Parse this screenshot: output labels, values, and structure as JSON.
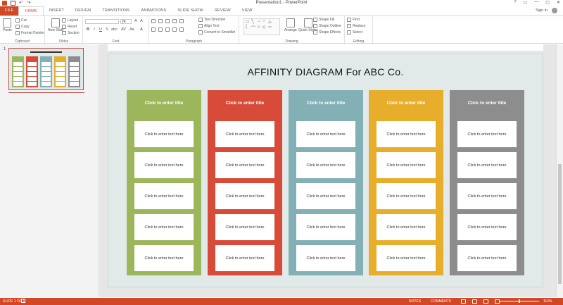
{
  "window": {
    "title": "Presentation1 - PowerPoint",
    "controls": [
      "?",
      "▭",
      "—",
      "▢",
      "✕"
    ]
  },
  "tabs": [
    {
      "label": "FILE"
    },
    {
      "label": "HOME"
    },
    {
      "label": "INSERT"
    },
    {
      "label": "DESIGN"
    },
    {
      "label": "TRANSITIONS"
    },
    {
      "label": "ANIMATIONS"
    },
    {
      "label": "SLIDE SHOW"
    },
    {
      "label": "REVIEW"
    },
    {
      "label": "VIEW"
    }
  ],
  "account": {
    "signin": "Sign in"
  },
  "ribbon": {
    "clipboard": {
      "label": "Clipboard",
      "paste": "Paste",
      "cut": "Cut",
      "copy": "Copy",
      "format_painter": "Format Painter"
    },
    "slides": {
      "label": "Slides",
      "new_slide": "New Slide",
      "layout": "Layout",
      "reset": "Reset",
      "section": "Section"
    },
    "font": {
      "label": "Font",
      "size": "24"
    },
    "paragraph": {
      "label": "Paragraph",
      "text_direction": "Text Direction",
      "align_text": "Align Text",
      "smartart": "Convert to SmartArt"
    },
    "drawing": {
      "label": "Drawing",
      "arrange": "Arrange",
      "quick_styles": "Quick Styles",
      "shape_fill": "Shape Fill",
      "shape_outline": "Shape Outline",
      "shape_effects": "Shape Effects"
    },
    "editing": {
      "label": "Editing",
      "find": "Find",
      "replace": "Replace",
      "select": "Select"
    }
  },
  "thumbnail_pane": {
    "slide_number": "1"
  },
  "slide": {
    "title": "AFFINITY DIAGRAM For ABC Co.",
    "columns": [
      {
        "title": "Click to enter title",
        "color": "#9cb65c",
        "cards": [
          "Click to enter text here",
          "Click to enter text here",
          "Click to enter text here",
          "Click to enter text here",
          "Click to enter text here"
        ]
      },
      {
        "title": "Click to enter title",
        "color": "#d74b38",
        "cards": [
          "Click to enter text here",
          "Click to enter text here",
          "Click to enter text here",
          "Click to enter text here",
          "Click to enter text here"
        ]
      },
      {
        "title": "Click to enter title",
        "color": "#82b0b5",
        "cards": [
          "Click to enter text here",
          "Click to enter text here",
          "Click to enter text here",
          "Click to enter text here",
          "Click to enter text here"
        ]
      },
      {
        "title": "Click to enter title",
        "color": "#e7ae2b",
        "cards": [
          "Click to enter text here",
          "Click to enter text here",
          "Click to enter text here",
          "Click to enter text here",
          "Click to enter text here"
        ]
      },
      {
        "title": "Click to enter title",
        "color": "#8d8d8d",
        "cards": [
          "Click to enter text here",
          "Click to enter text here",
          "Click to enter text here",
          "Click to enter text here",
          "Click to enter text here"
        ]
      }
    ]
  },
  "status": {
    "slide_info": "SLIDE 1 OF 1",
    "notes": "NOTES",
    "comments": "COMMENTS",
    "zoom": "116%"
  },
  "colors": {
    "accent": "#d24726"
  }
}
